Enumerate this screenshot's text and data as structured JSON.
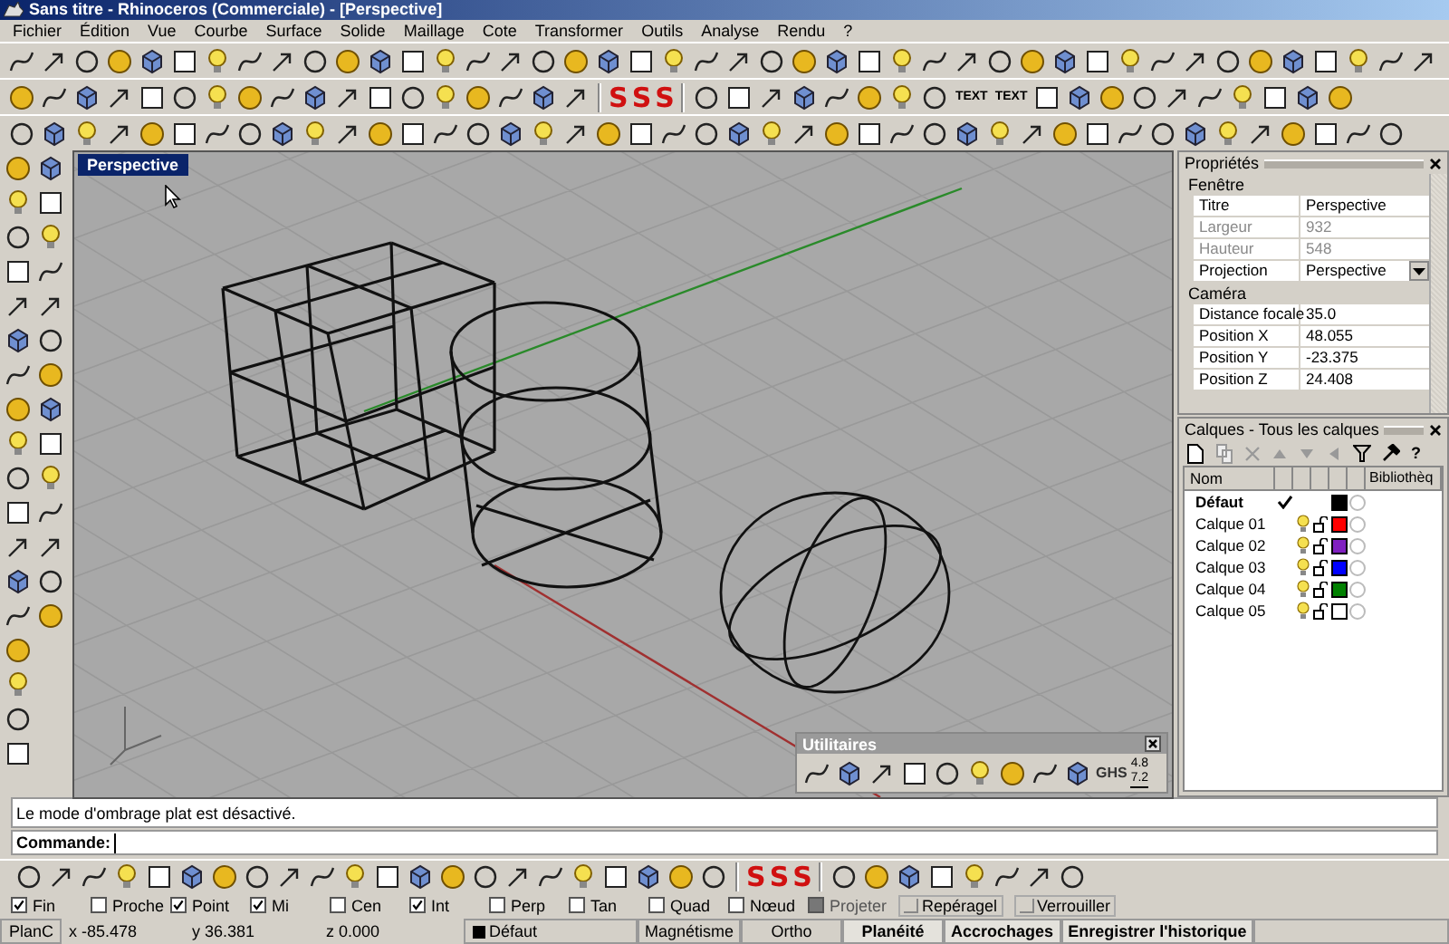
{
  "window": {
    "title": "Sans titre - Rhinoceros (Commerciale) - [Perspective]"
  },
  "menu": [
    "Fichier",
    "Édition",
    "Vue",
    "Courbe",
    "Surface",
    "Solide",
    "Maillage",
    "Cote",
    "Transformer",
    "Outils",
    "Analyse",
    "Rendu",
    "?"
  ],
  "toolbar_marks": {
    "sss": [
      "S",
      "S",
      "S"
    ],
    "text": [
      "TEXT",
      "TEXT"
    ]
  },
  "viewport": {
    "title": "Perspective"
  },
  "properties": {
    "title": "Propriétés",
    "sections": [
      {
        "title": "Fenêtre",
        "rows": [
          {
            "label": "Titre",
            "value": "Perspective",
            "kind": "text",
            "disabled": false
          },
          {
            "label": "Largeur",
            "value": "932",
            "kind": "text",
            "disabled": true
          },
          {
            "label": "Hauteur",
            "value": "548",
            "kind": "text",
            "disabled": true
          },
          {
            "label": "Projection",
            "value": "Perspective",
            "kind": "dropdown",
            "disabled": false
          }
        ]
      },
      {
        "title": "Caméra",
        "rows": [
          {
            "label": "Distance focale",
            "value": "35.0",
            "kind": "text",
            "disabled": false
          },
          {
            "label": "Position X",
            "value": "48.055",
            "kind": "text",
            "disabled": false
          },
          {
            "label": "Position Y",
            "value": "-23.375",
            "kind": "text",
            "disabled": false
          },
          {
            "label": "Position Z",
            "value": "24.408",
            "kind": "text",
            "disabled": false
          }
        ]
      }
    ]
  },
  "layers": {
    "title": "Calques - Tous les calques",
    "help": "?",
    "columns": [
      "Nom",
      "Bibliothèq"
    ],
    "rows": [
      {
        "name": "Défaut",
        "current": true,
        "color": "#000000"
      },
      {
        "name": "Calque 01",
        "current": false,
        "color": "#ff0000"
      },
      {
        "name": "Calque 02",
        "current": false,
        "color": "#8020c0"
      },
      {
        "name": "Calque 03",
        "current": false,
        "color": "#0000ff"
      },
      {
        "name": "Calque 04",
        "current": false,
        "color": "#008000"
      },
      {
        "name": "Calque 05",
        "current": false,
        "color": "#ffffff"
      }
    ]
  },
  "utilities": {
    "title": "Utilitaires",
    "mark": "GHS",
    "scale": [
      "4.8",
      "7.2"
    ]
  },
  "command": {
    "history": "Le mode d'ombrage plat est désactivé.",
    "prompt": "Commande:"
  },
  "snap_marks": [
    "S",
    "S",
    "S"
  ],
  "osnaps": [
    {
      "label": "Fin",
      "checked": true,
      "disabled": false,
      "kind": "checkbox"
    },
    {
      "label": "Proche",
      "checked": false,
      "disabled": false,
      "kind": "checkbox"
    },
    {
      "label": "Point",
      "checked": true,
      "disabled": false,
      "kind": "checkbox"
    },
    {
      "label": "Mi",
      "checked": true,
      "disabled": false,
      "kind": "checkbox"
    },
    {
      "label": "Cen",
      "checked": false,
      "disabled": false,
      "kind": "checkbox"
    },
    {
      "label": "Int",
      "checked": true,
      "disabled": false,
      "kind": "checkbox"
    },
    {
      "label": "Perp",
      "checked": false,
      "disabled": false,
      "kind": "checkbox"
    },
    {
      "label": "Tan",
      "checked": false,
      "disabled": false,
      "kind": "checkbox"
    },
    {
      "label": "Quad",
      "checked": false,
      "disabled": false,
      "kind": "checkbox"
    },
    {
      "label": "Nœud",
      "checked": false,
      "disabled": false,
      "kind": "checkbox"
    },
    {
      "label": "Projeter",
      "checked": false,
      "disabled": true,
      "kind": "checkbox"
    },
    {
      "label": "Repéragel",
      "checked": false,
      "disabled": false,
      "kind": "toggle"
    },
    {
      "label": "Verrouiller",
      "checked": false,
      "disabled": false,
      "kind": "toggle"
    }
  ],
  "status": {
    "plane": "PlanC",
    "x": "x -85.478",
    "y": "y 36.381",
    "z": "z 0.000",
    "layer": "Défaut",
    "panes": [
      {
        "label": "Magnétisme",
        "on": false
      },
      {
        "label": "Ortho",
        "on": false
      },
      {
        "label": "Planéité",
        "on": true
      },
      {
        "label": "Accrochages",
        "on": true
      },
      {
        "label": "Enregistrer l'historique",
        "on": true
      }
    ]
  }
}
